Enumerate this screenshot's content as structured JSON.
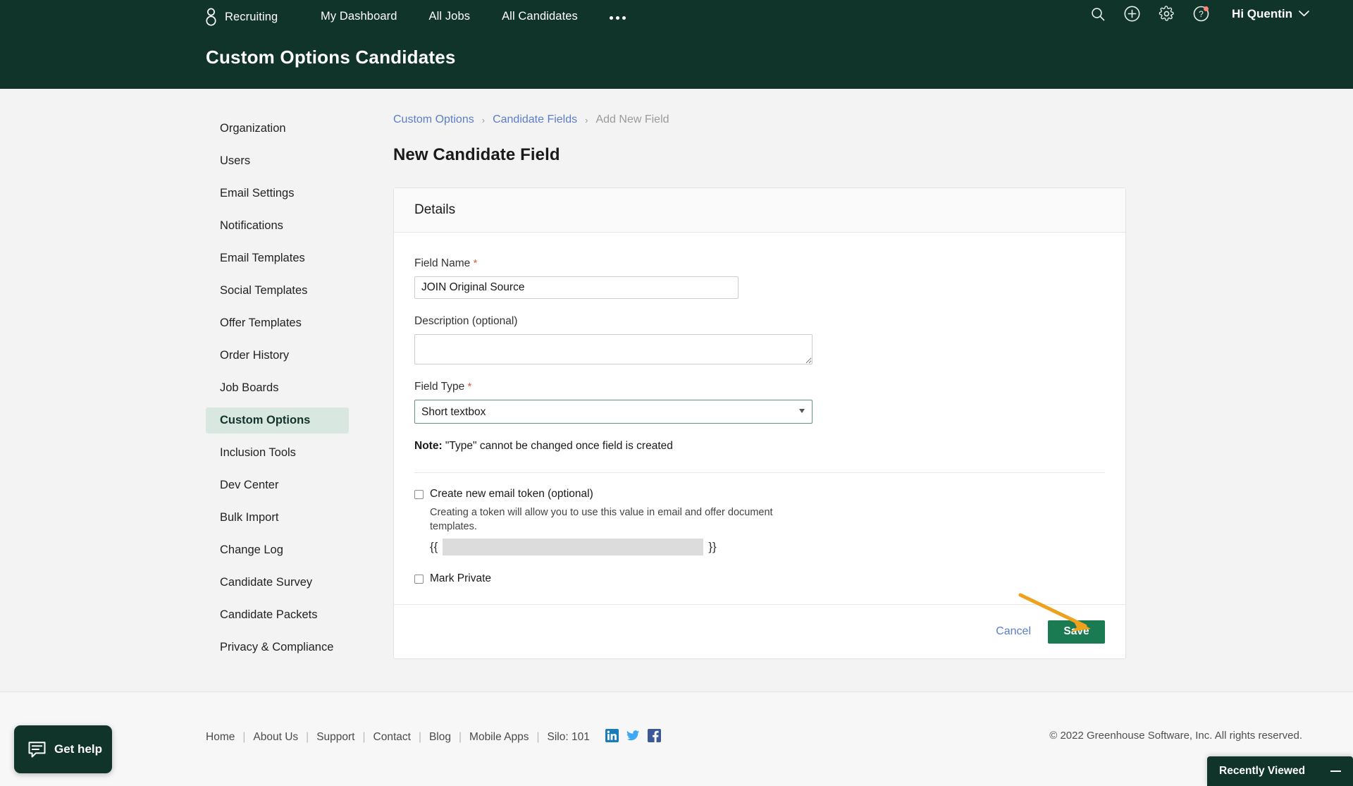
{
  "header": {
    "brand": "Recruiting",
    "nav": [
      {
        "label": "My Dashboard"
      },
      {
        "label": "All Jobs"
      },
      {
        "label": "All Candidates"
      }
    ],
    "more_label": "",
    "user_greeting": "Hi Quentin",
    "page_title": "Custom Options Candidates",
    "icons": {
      "logo": "greenhouse-g-logo",
      "search": "search-icon",
      "add": "plus-circle-icon",
      "settings": "gear-icon",
      "help": "help-question-icon",
      "chevron": "chevron-down-icon"
    },
    "colors": {
      "header_bg": "#11342a",
      "notification_dot": "#ff8474"
    }
  },
  "sidebar": {
    "items": [
      {
        "label": "Organization",
        "active": false
      },
      {
        "label": "Users",
        "active": false
      },
      {
        "label": "Email Settings",
        "active": false
      },
      {
        "label": "Notifications",
        "active": false
      },
      {
        "label": "Email Templates",
        "active": false
      },
      {
        "label": "Social Templates",
        "active": false
      },
      {
        "label": "Offer Templates",
        "active": false
      },
      {
        "label": "Order History",
        "active": false
      },
      {
        "label": "Job Boards",
        "active": false
      },
      {
        "label": "Custom Options",
        "active": true
      },
      {
        "label": "Inclusion Tools",
        "active": false
      },
      {
        "label": "Dev Center",
        "active": false
      },
      {
        "label": "Bulk Import",
        "active": false
      },
      {
        "label": "Change Log",
        "active": false
      },
      {
        "label": "Candidate Survey",
        "active": false
      },
      {
        "label": "Candidate Packets",
        "active": false
      },
      {
        "label": "Privacy & Compliance",
        "active": false
      }
    ]
  },
  "breadcrumb": {
    "item1": "Custom Options",
    "sep1": "›",
    "item2": "Candidate Fields",
    "sep2": "›",
    "current": "Add New Field"
  },
  "main": {
    "heading": "New Candidate Field",
    "card_title": "Details",
    "field_name": {
      "label": "Field Name",
      "required_marker": "*",
      "value": "JOIN Original Source",
      "placeholder": ""
    },
    "description": {
      "label": "Description (optional)",
      "value": "",
      "placeholder": ""
    },
    "field_type": {
      "label": "Field Type",
      "required_marker": "*",
      "selected": "Short textbox",
      "options": [
        "Short textbox"
      ]
    },
    "note": {
      "prefix": "Note:",
      "text": "\"Type\" cannot be changed once field is created"
    },
    "email_token": {
      "checkbox_label": "Create new email token (optional)",
      "checked": false,
      "help": "Creating a token will allow you to use this value in email and offer document templates.",
      "brace_open": "{{",
      "brace_close": "}}",
      "token_value": "",
      "token_placeholder": ""
    },
    "mark_private": {
      "label": "Mark Private",
      "checked": false
    },
    "actions": {
      "cancel": "Cancel",
      "save": "Save",
      "save_color": "#1a7a52",
      "annotation_arrow_color": "#eda11d"
    }
  },
  "footer": {
    "links": [
      "Home",
      "About Us",
      "Support",
      "Contact",
      "Blog",
      "Mobile Apps"
    ],
    "silo": "Silo: 101",
    "social": [
      "linkedin-icon",
      "twitter-icon",
      "facebook-icon"
    ],
    "copyright": "© 2022 Greenhouse Software, Inc. All rights reserved."
  },
  "widgets": {
    "get_help": "Get help",
    "recently_viewed": "Recently Viewed"
  }
}
